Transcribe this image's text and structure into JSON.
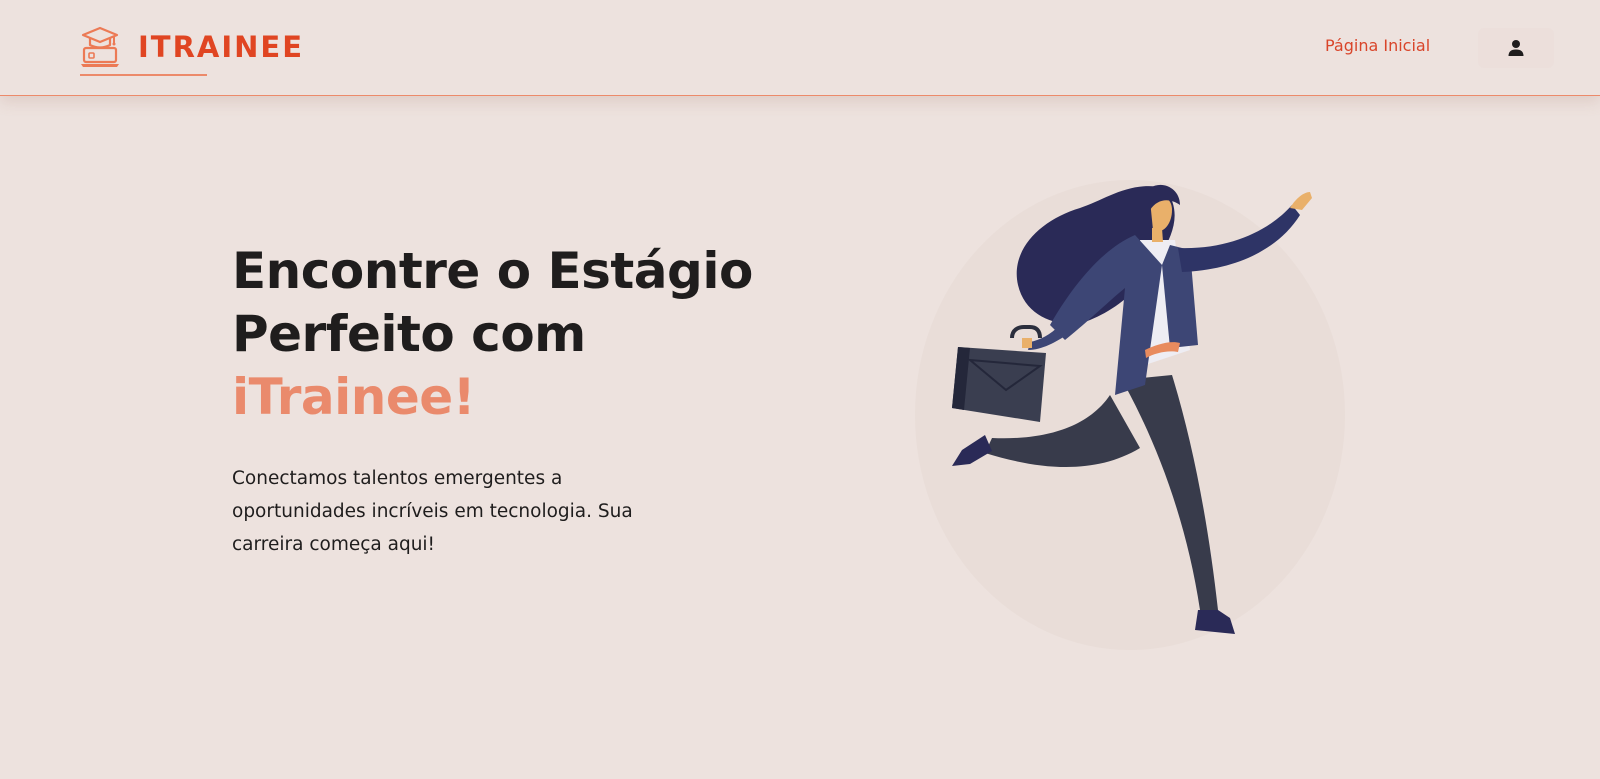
{
  "header": {
    "brand_name": "ITRAINEE",
    "brand_icon": "graduation-cap-laptop-icon",
    "nav": {
      "home_label": "Página Inicial"
    },
    "user_icon": "user-icon"
  },
  "hero": {
    "title_line1": "Encontre o Estágio",
    "title_line2": "Perfeito com",
    "title_accent": "iTrainee!",
    "description": "Conectamos talentos emergentes a oportunidades incríveis em tecnologia. Sua carreira começa aqui!",
    "illustration": "running-woman-with-briefcase-illustration"
  },
  "colors": {
    "background": "#ede2de",
    "brand": "#e04522",
    "accent": "#ea8a6c",
    "text": "#1f1d1d",
    "nav_border": "#ec8a6a"
  }
}
